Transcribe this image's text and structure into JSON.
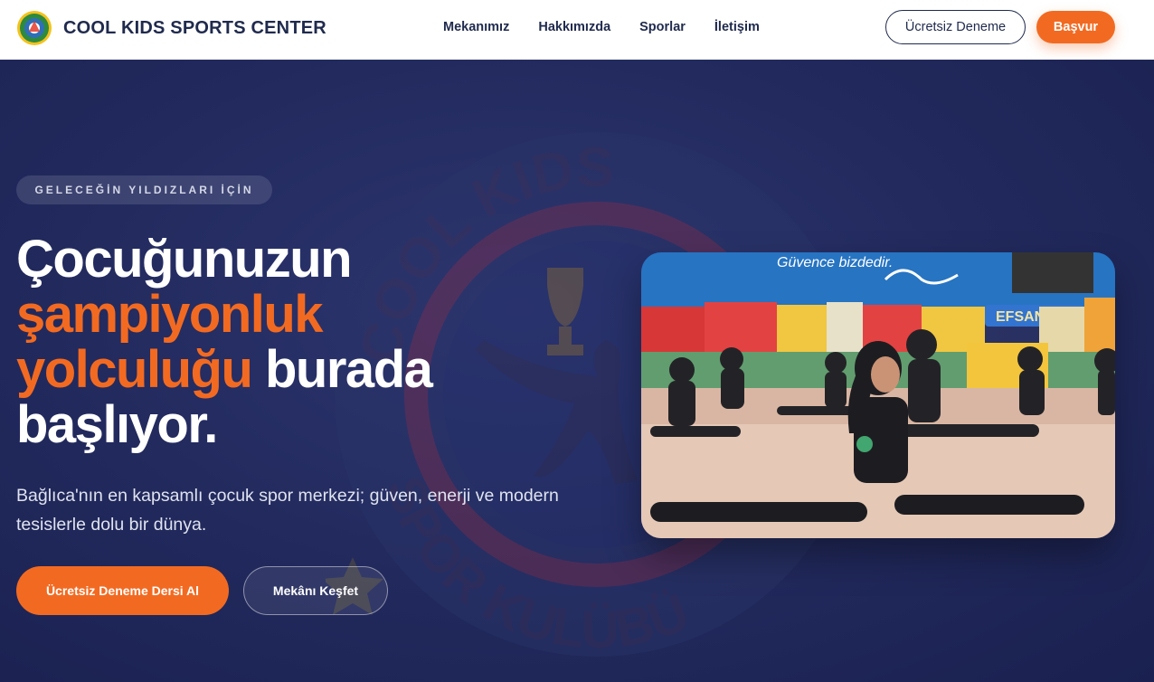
{
  "header": {
    "brand_name": "COOL KIDS SPORTS CENTER",
    "logo_icon": "club-logo-icon",
    "nav": [
      "Mekanımız",
      "Hakkımızda",
      "Sporlar",
      "İletişim"
    ],
    "trial_button": "Ücretsiz Deneme",
    "apply_button": "Başvur"
  },
  "hero": {
    "badge": "GELECEĞİN YILDIZLARI İÇİN",
    "headline": {
      "line1": "Çocuğunuzun",
      "line2_accent": "şampiyonluk",
      "line3_accent": "yolculuğu",
      "line3_rest": " burada",
      "line4": "başlıyor."
    },
    "subtext": "Bağlıca'nın en kapsamlı çocuk spor merkezi; güven, enerji ve modern tesislerle dolu bir dünya.",
    "primary_cta": "Ücretsiz Deneme Dersi Al",
    "secondary_cta": "Mekânı Keşfet",
    "background_emblem_text": [
      "COOL KIDS",
      "SPOR KULÜBÜ"
    ],
    "photo_banner_text": [
      "Güvence bizdedir.",
      "EFSANE"
    ]
  },
  "colors": {
    "accent": "#f26a21",
    "navy": "#1f2a4d",
    "hero_bg": "#232b5f"
  }
}
